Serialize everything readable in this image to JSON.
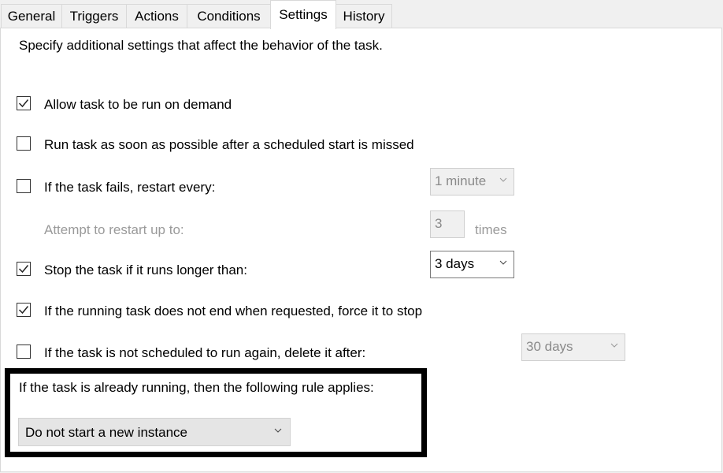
{
  "tabs": [
    {
      "label": "General"
    },
    {
      "label": "Triggers"
    },
    {
      "label": "Actions"
    },
    {
      "label": "Conditions"
    },
    {
      "label": "Settings"
    },
    {
      "label": "History"
    }
  ],
  "active_tab": "Settings",
  "description": "Specify additional settings that affect the behavior of the task.",
  "options": {
    "allow_on_demand": {
      "label": "Allow task to be run on demand",
      "checked": true
    },
    "run_asap": {
      "label": "Run task as soon as possible after a scheduled start is missed",
      "checked": false
    },
    "restart_on_fail": {
      "label": "If the task fails, restart every:",
      "checked": false,
      "interval": "1 minute"
    },
    "restart_attempts": {
      "label": "Attempt to restart up to:",
      "count": "3",
      "unit": "times"
    },
    "stop_if_longer": {
      "label": "Stop the task if it runs longer than:",
      "checked": true,
      "duration": "3 days"
    },
    "force_stop": {
      "label": "If the running task does not end when requested, force it to stop",
      "checked": true
    },
    "delete_after": {
      "label": "If the task is not scheduled to run again, delete it after:",
      "checked": false,
      "duration": "30 days"
    }
  },
  "running_rule": {
    "label": "If the task is already running, then the following rule applies:",
    "value": "Do not start a new instance"
  }
}
